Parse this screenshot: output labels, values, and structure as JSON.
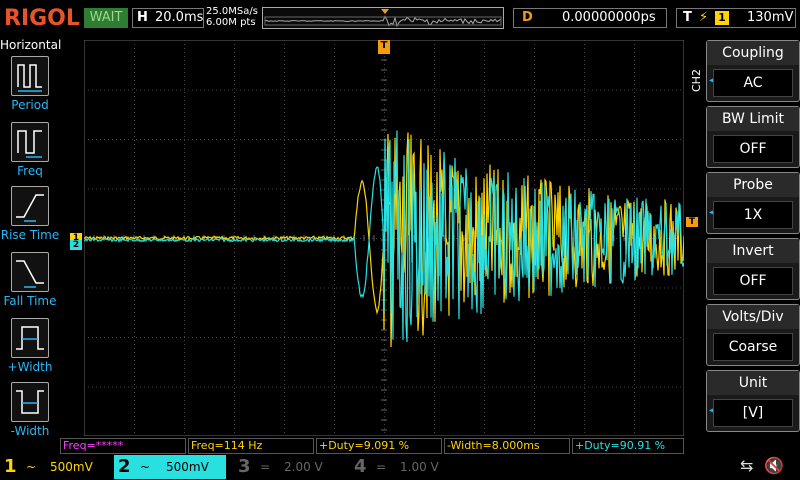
{
  "brand": "RIGOL",
  "run_state": "WAIT",
  "horizontal": {
    "label": "H",
    "timebase": "20.0ms"
  },
  "acq": {
    "sample_rate": "25.0MSa/s",
    "points": "6.00M pts"
  },
  "delay": {
    "label": "D",
    "value": "0.00000000ps"
  },
  "trigger": {
    "label": "T",
    "edge": "rising-edge-icon",
    "source": "1",
    "level": "130mV"
  },
  "left_menu": {
    "title": "Horizontal",
    "items": [
      {
        "label": "Period",
        "icon": "period-icon"
      },
      {
        "label": "Freq",
        "icon": "freq-icon"
      },
      {
        "label": "Rise Time",
        "icon": "rise-time-icon"
      },
      {
        "label": "Fall Time",
        "icon": "fall-time-icon"
      },
      {
        "label": "+Width",
        "icon": "pos-width-icon"
      },
      {
        "label": "-Width",
        "icon": "neg-width-icon"
      }
    ]
  },
  "right_menu": {
    "channel": "CH2",
    "items": [
      {
        "label": "Coupling",
        "value": "AC"
      },
      {
        "label": "BW Limit",
        "value": "OFF"
      },
      {
        "label": "Probe",
        "value": "1X"
      },
      {
        "label": "Invert",
        "value": "OFF"
      },
      {
        "label": "Volts/Div",
        "value": "Coarse"
      },
      {
        "label": "Unit",
        "value": "[V]"
      }
    ]
  },
  "measurements": [
    {
      "text": "Freq=*****",
      "color": "#ff40ff"
    },
    {
      "text": "Freq=114 Hz",
      "color": "#ffd400"
    },
    {
      "text": "+Duty=9.091 %",
      "color": "#ffd400"
    },
    {
      "text": "-Width=8.000ms",
      "color": "#ffd400"
    },
    {
      "text": "+Duty=90.91 %",
      "color": "#29e0e0"
    }
  ],
  "channels": [
    {
      "num": "1",
      "coupling": "~",
      "scale": "500mV",
      "color": "#ffd400",
      "active": true
    },
    {
      "num": "2",
      "coupling": "~",
      "scale": "500mV",
      "color": "#29e0e0",
      "active": true
    },
    {
      "num": "3",
      "coupling": "=",
      "scale": "2.00 V",
      "color": "#666666",
      "active": false
    },
    {
      "num": "4",
      "coupling": "=",
      "scale": "1.00 V",
      "color": "#666666",
      "active": false
    }
  ],
  "markers": {
    "ch1": "1",
    "ch2": "2",
    "trig_pos": "T",
    "trig_level": "T"
  },
  "colors": {
    "ch1": "#ffd400",
    "ch2": "#29e0e0",
    "trigger": "#f39c12",
    "menu_accent": "#29b6f6"
  }
}
